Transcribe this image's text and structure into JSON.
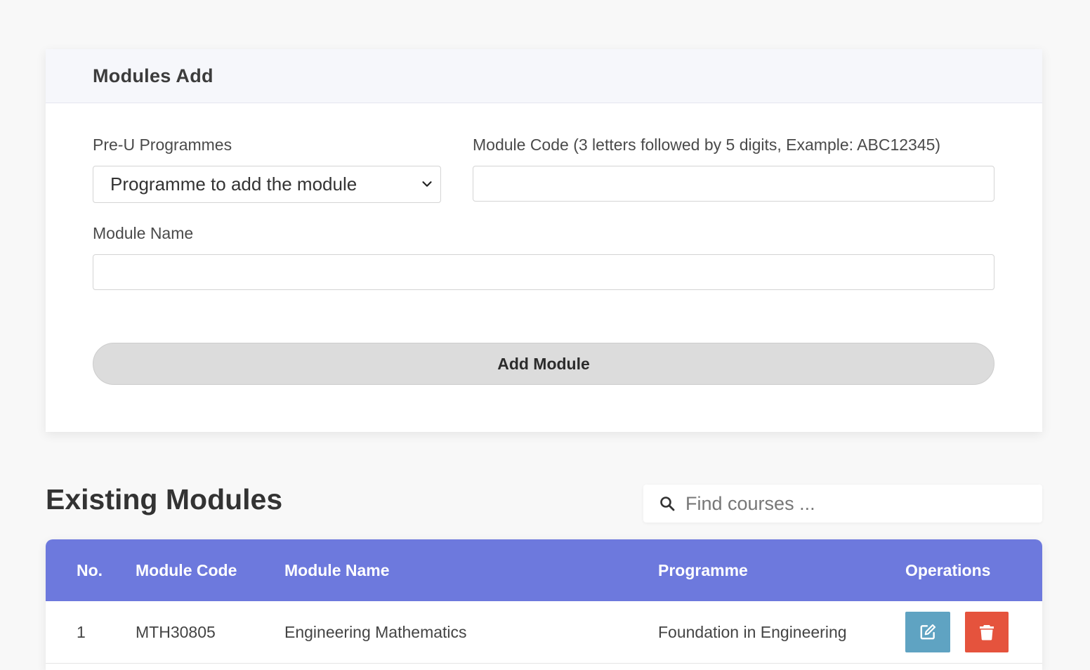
{
  "form": {
    "title": "Modules Add",
    "programme_label": "Pre-U Programmes",
    "programme_selected": "Programme to add the module",
    "code_label": "Module Code (3 letters followed by 5 digits, Example: ABC12345)",
    "code_value": "",
    "name_label": "Module Name",
    "name_value": "",
    "submit_label": "Add Module"
  },
  "existing": {
    "title": "Existing Modules",
    "search_placeholder": "Find courses ...",
    "columns": [
      "No.",
      "Module Code",
      "Module Name",
      "Programme",
      "Operations"
    ],
    "rows": [
      {
        "no": "1",
        "code": "MTH30805",
        "name": "Engineering Mathematics",
        "programme": "Foundation in Engineering"
      }
    ]
  },
  "colors": {
    "table_header": "#6d79dd",
    "edit_button": "#5fa3c2",
    "delete_button": "#e5533d"
  },
  "icons": {
    "select": "chevron-down-icon",
    "search": "search-icon",
    "edit": "edit-icon",
    "delete": "trash-icon"
  }
}
